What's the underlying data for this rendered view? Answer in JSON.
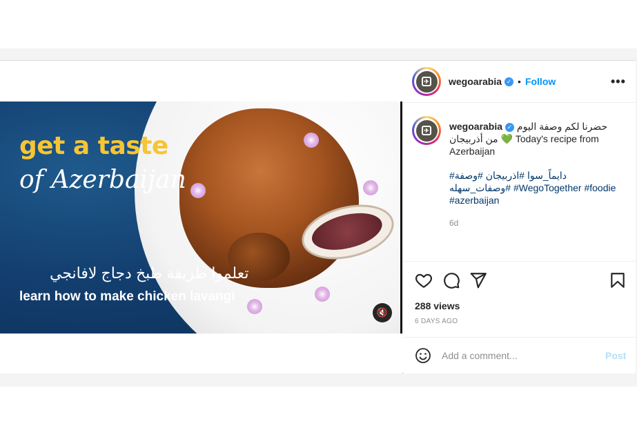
{
  "post": {
    "author": {
      "username": "wegoarabia",
      "verified_icon": "verified-badge-icon",
      "separator": "•",
      "follow_label": "Follow",
      "more_label": "•••"
    },
    "video": {
      "title_line_1": "get a taste",
      "title_line_2": "of Azerbaijan",
      "subtitle_ar": "تعلموا طريقة طبخ دجاج لافانجي",
      "subtitle_en": "learn how to make chicken lavangi",
      "mute_icon": "speaker-muted-icon",
      "mute_glyph": "🔇"
    },
    "caption": {
      "username": "wegoarabia",
      "text_ar": "حضرنا لكم وصفة اليوم من أذربيجان",
      "heart": "💚",
      "text_en": "Today's recipe from Azerbaijan",
      "hashtags": [
        "#دايماً_سوا",
        "#اذربيجان",
        "#وصفة",
        "#وصفات_سهله",
        "#WegoTogether",
        "#foodie",
        "#azerbaijan"
      ],
      "age": "6d"
    },
    "actions": {
      "like_icon": "heart-icon",
      "comment_icon": "comment-icon",
      "share_icon": "share-icon",
      "save_icon": "bookmark-icon"
    },
    "stats": {
      "views": "288 views",
      "date": "6 DAYS AGO"
    },
    "comment_box": {
      "emoji_icon": "emoji-icon",
      "placeholder": "Add a comment...",
      "post_label": "Post"
    }
  },
  "colors": {
    "accent": "#0095f6",
    "title_yellow": "#f7c534",
    "video_blue": "#133f70",
    "hashtag": "#00376b",
    "muted_text": "#8e8e8e"
  }
}
